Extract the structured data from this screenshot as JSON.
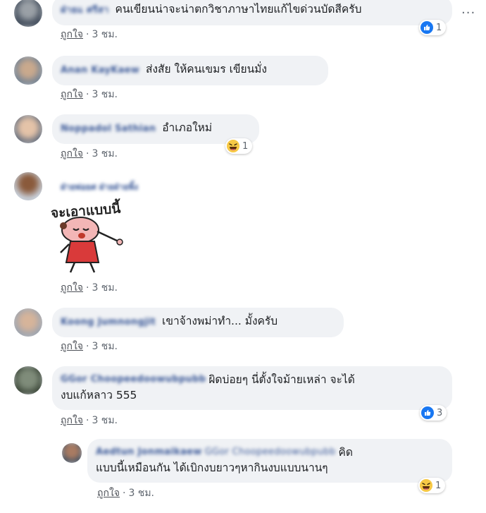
{
  "meta": {
    "like_label": "ถูกใจ",
    "separator": "·",
    "time_label": "3 ชม."
  },
  "comments": [
    {
      "name": "ฝ่ายแ ศรีสา",
      "text": "คนเขียนน่าจะน่าตกวิชาภาษาไทยแก้ไขด่วนบัดสีครับ",
      "reaction": {
        "type": "like",
        "count": "1"
      }
    },
    {
      "name": "Anan KayKaew",
      "text": "ส่งสัย ให้คนเขมร เขียนมั่ง"
    },
    {
      "name": "Noppadol Sathian",
      "text": "อำเภอใหม่",
      "reaction": {
        "type": "haha",
        "count": "1"
      }
    },
    {
      "name": "ฝ่ายพ่อยศ ฝ่ายฝ่ายพิ้ง",
      "sticker_text": "จะเอาแบบนี้"
    },
    {
      "name": "Koong Jumnongjit",
      "text": "เขาจ้างพม่าทำ... มั้งครับ"
    },
    {
      "name": "GGor Choopeedoowubpubb",
      "text_line1": "ผิดบ่อยๆ นี่ตั้งใจม้ายเหล่า จะได้",
      "text_line2": "งบแก้หลาว 555",
      "reaction": {
        "type": "like",
        "count": "3"
      }
    },
    {
      "name": "Aedtun Jonmaikaew",
      "mention": "GGor Choopeedoowubpubb",
      "text_line1": "คิด",
      "text_line2": "แบบนี้เหมือนกัน ได้เบิกงบยาวๆหากินงบแบบนานๆ",
      "reaction": {
        "type": "haha",
        "count": "1"
      }
    }
  ],
  "colors": {
    "bubble_bg": "#f0f2f5",
    "name_color": "#3b5998",
    "like_blue": "#1877f2",
    "haha_yellow": "#f7c946"
  }
}
